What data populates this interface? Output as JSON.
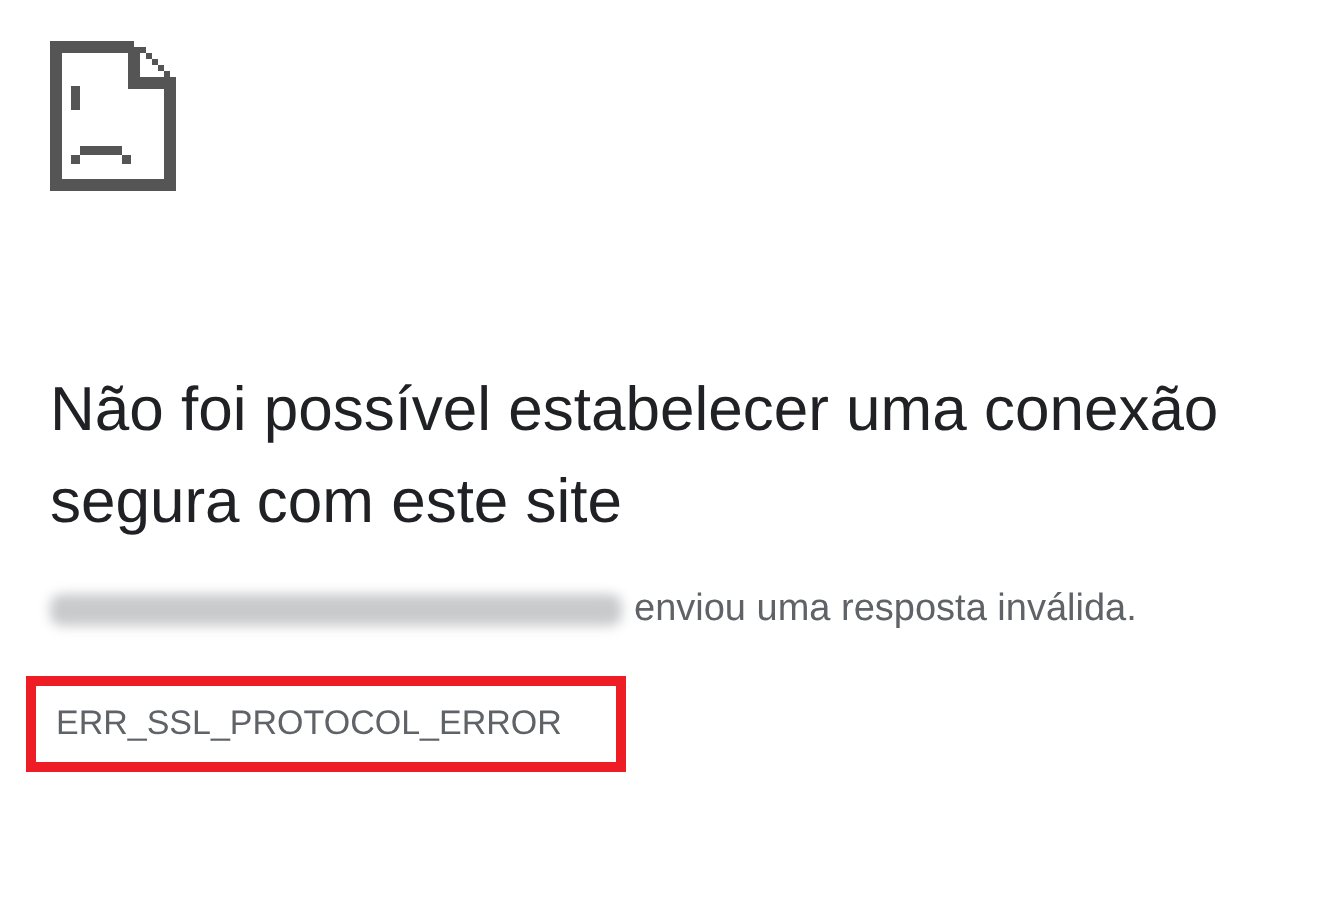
{
  "heading": "Não foi possível estabelecer uma conexão segura com este site",
  "message": {
    "domain_redacted": true,
    "text": "enviou uma resposta inválida."
  },
  "error_code": {
    "text": "ERR_SSL_PROTOCOL_ERROR",
    "highlighted": true
  }
}
